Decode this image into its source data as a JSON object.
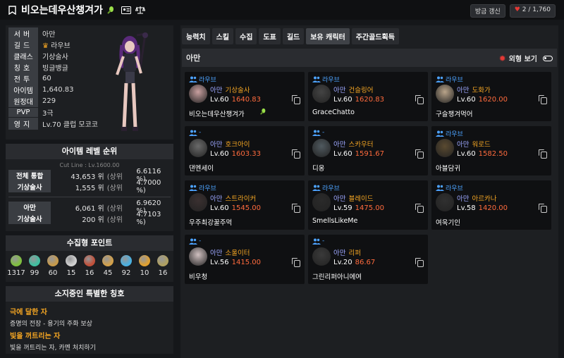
{
  "header": {
    "title": "비오는데우산챙겨가",
    "refresh_label": "방금 갱신",
    "likes": "2 / 1,760"
  },
  "profile": {
    "rows": [
      {
        "label": "서버",
        "value": "아만"
      },
      {
        "label": "길드",
        "value": "라우브"
      },
      {
        "label": "클래스",
        "value": "기상술사"
      },
      {
        "label": "칭호",
        "value": "빙글뱅글"
      },
      {
        "label": "전투",
        "value": "60"
      },
      {
        "label": "아이템",
        "value": "1,640.83"
      },
      {
        "label": "원정대",
        "value": "229"
      },
      {
        "label": "PVP",
        "value": "3극"
      },
      {
        "label": "영지",
        "value": "Lv.70 클럽 모코코"
      }
    ]
  },
  "ranking": {
    "title": "아이템 레벨 순위",
    "cutline": "Cut Line : Lv.1600.00",
    "rows": [
      {
        "label": "전체 통합",
        "rank": "43,653 위",
        "paren": "(상위",
        "pct": "6.6116 %)"
      },
      {
        "label": "기상술사",
        "rank": "1,555 위",
        "paren": "(상위",
        "pct": "4.7000 %)"
      },
      {
        "label": "아만",
        "rank": "6,061 위",
        "paren": "(상위",
        "pct": "6.9620 %)"
      },
      {
        "label": "기상술사",
        "rank": "200 위",
        "paren": "(상위",
        "pct": "4.7103 %)"
      }
    ]
  },
  "collection": {
    "title": "수집형 포인트",
    "items": [
      {
        "icon": "mokoko-seed-icon",
        "color": "#7fbf3f",
        "value": "1317"
      },
      {
        "icon": "island-heart-icon",
        "color": "#3fbfa0",
        "value": "99"
      },
      {
        "icon": "great-art-icon",
        "color": "#c79a4a",
        "value": "60"
      },
      {
        "icon": "giant-heart-icon",
        "color": "#d0d0d0",
        "value": "15"
      },
      {
        "icon": "ignea-token-icon",
        "color": "#c0503a",
        "value": "16"
      },
      {
        "icon": "adventure-book-icon",
        "color": "#d2a04a",
        "value": "45"
      },
      {
        "icon": "sea-voyage-icon",
        "color": "#4ab0e0",
        "value": "92"
      },
      {
        "icon": "world-tree-leaf-icon",
        "color": "#e0a030",
        "value": "10"
      },
      {
        "icon": "orpheus-star-icon",
        "color": "#b0a060",
        "value": "16"
      }
    ]
  },
  "titles": {
    "title": "소지중인 특별한 칭호",
    "items": [
      {
        "name": "극에 달한 자",
        "desc": "증명의 전장 - 용기의 주화 보상"
      },
      {
        "name": "빛을 꺼트리는 자",
        "desc": "빛을 꺼트리는 자, 카멘 처치하기"
      }
    ]
  },
  "tabs": [
    "능력치",
    "스킬",
    "수집",
    "도표",
    "길드",
    "보유 캐릭터",
    "주간골드획득"
  ],
  "server_bar": {
    "server": "아만",
    "look_label": "외형 보기"
  },
  "characters": [
    {
      "guild": "라우브",
      "server": "아만",
      "class": "기상술사",
      "level": "Lv.60",
      "ilvl": "1640.83",
      "name": "비오는데우산챙겨가"
    },
    {
      "guild": "라우브",
      "server": "아만",
      "class": "건슬링어",
      "level": "Lv.60",
      "ilvl": "1620.83",
      "name": "GraceChatto"
    },
    {
      "guild": "라우브",
      "server": "아만",
      "class": "도화가",
      "level": "Lv.60",
      "ilvl": "1620.00",
      "name": "구슬챙겨먹어"
    },
    {
      "guild": "-",
      "server": "아만",
      "class": "호크아이",
      "level": "Lv.60",
      "ilvl": "1603.33",
      "name": "댄멘세이"
    },
    {
      "guild": "-",
      "server": "아만",
      "class": "스카우터",
      "level": "Lv.60",
      "ilvl": "1591.67",
      "name": "디옹"
    },
    {
      "guild": "라우브",
      "server": "아만",
      "class": "워로드",
      "level": "Lv.60",
      "ilvl": "1582.50",
      "name": "아블담귀"
    },
    {
      "guild": "라우브",
      "server": "아만",
      "class": "스트라이커",
      "level": "Lv.60",
      "ilvl": "1545.00",
      "name": "우주최강꿀주먹"
    },
    {
      "guild": "라우브",
      "server": "아만",
      "class": "블레이드",
      "level": "Lv.59",
      "ilvl": "1475.00",
      "name": "SmellsLikeMe"
    },
    {
      "guild": "라우브",
      "server": "아만",
      "class": "아르카나",
      "level": "Lv.58",
      "ilvl": "1420.00",
      "name": "여욱기인"
    },
    {
      "guild": "-",
      "server": "아만",
      "class": "소울이터",
      "level": "Lv.56",
      "ilvl": "1415.00",
      "name": "비우청"
    },
    {
      "guild": "-",
      "server": "아만",
      "class": "리퍼",
      "level": "Lv.20",
      "ilvl": "86.67",
      "name": "그린리퍼아니에여"
    }
  ],
  "colors": {
    "accent": "#f5a623",
    "guild_blue": "#4da3ff",
    "item_level": "#ff6b3d",
    "heart": "#e53935"
  }
}
